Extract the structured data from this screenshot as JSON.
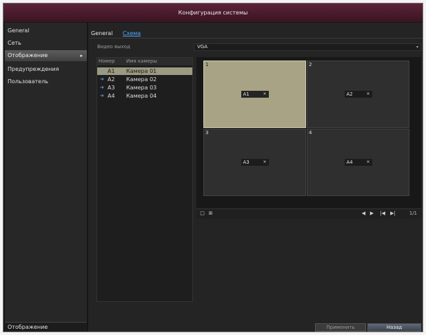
{
  "window": {
    "title": "Конфигурация системы"
  },
  "sidebar": {
    "items": [
      {
        "label": "General"
      },
      {
        "label": "Сеть"
      },
      {
        "label": "Отображение",
        "active": true,
        "arrow": "▸"
      },
      {
        "label": "Предупреждения"
      },
      {
        "label": "Пользователь"
      }
    ],
    "bottom_label": "Отображение"
  },
  "tabs": [
    {
      "label": "General"
    },
    {
      "label": "Схема"
    }
  ],
  "video_output": {
    "label": "Видео выход",
    "value": "VGA",
    "chevron_icon": "chevron-down-icon"
  },
  "camera_list": {
    "headers": [
      "Номер",
      "Имя камеры"
    ],
    "rows": [
      {
        "icon": "camera-icon",
        "number": "A1",
        "name": "Камера 01",
        "selected": true
      },
      {
        "icon": "camera-icon",
        "number": "A2",
        "name": "Камера 02"
      },
      {
        "icon": "camera-icon",
        "number": "A3",
        "name": "Камера 03"
      },
      {
        "icon": "camera-icon",
        "number": "A4",
        "name": "Камера 04"
      }
    ]
  },
  "layout_grid": {
    "cells": [
      {
        "num": "1",
        "tag": "A1",
        "x": "×",
        "active": true
      },
      {
        "num": "2",
        "tag": "A2",
        "x": "×"
      },
      {
        "num": "3",
        "tag": "A3",
        "x": "×"
      },
      {
        "num": "4",
        "tag": "A4",
        "x": "×"
      }
    ]
  },
  "toolbar": {
    "single_icon": "□",
    "quad_icon": "⊞",
    "page": "1/1",
    "nav": [
      "◀",
      "▶",
      "|◀",
      "▶|"
    ]
  },
  "buttons": {
    "apply": "Применить",
    "back": "Назад"
  }
}
